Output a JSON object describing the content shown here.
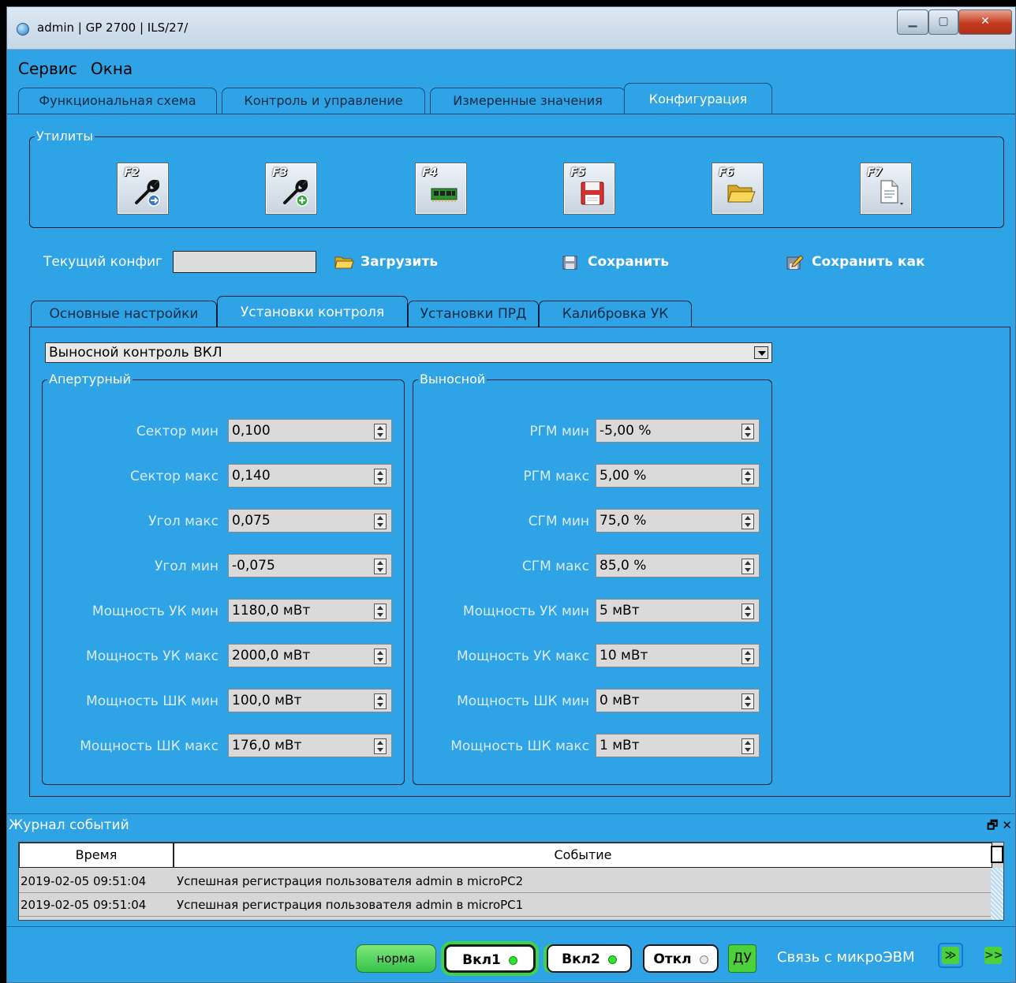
{
  "window": {
    "title": "admin | GP 2700 | ILS/27/"
  },
  "menu": [
    "Сервис",
    "Окна"
  ],
  "tabs": [
    "Функциональная схема",
    "Контроль и управление",
    "Измеренные значения",
    "Конфигурация"
  ],
  "utilities": {
    "label": "Утилиты",
    "buttons": [
      {
        "key": "F2",
        "icon": "wrench-arrow-icon"
      },
      {
        "key": "F3",
        "icon": "wrench-plus-icon"
      },
      {
        "key": "F4",
        "icon": "memory-chip-icon"
      },
      {
        "key": "F5",
        "icon": "floppy-save-icon"
      },
      {
        "key": "F6",
        "icon": "folder-open-icon"
      },
      {
        "key": "F7",
        "icon": "document-icon"
      }
    ]
  },
  "config": {
    "current_label": "Текущий конфиг",
    "current_value": "",
    "load_label": "Загрузить",
    "save_label": "Сохранить",
    "save_as_label": "Сохранить как"
  },
  "subtabs": [
    "Основные настройки",
    "Установки контроля",
    "Установки ПРД",
    "Калибровка УК"
  ],
  "control_mode": "Выносной контроль ВКЛ",
  "aperture": {
    "label": "Апертурный",
    "fields": [
      {
        "label": "Сектор мин",
        "value": "0,100"
      },
      {
        "label": "Сектор макс",
        "value": "0,140"
      },
      {
        "label": "Угол макс",
        "value": "0,075"
      },
      {
        "label": "Угол мин",
        "value": "-0,075"
      },
      {
        "label": "Мощность УК мин",
        "value": "1180,0 мВт"
      },
      {
        "label": "Мощность УК макс",
        "value": "2000,0 мВт"
      },
      {
        "label": "Мощность ШК мин",
        "value": "100,0 мВт"
      },
      {
        "label": "Мощность ШК макс",
        "value": "176,0 мВт"
      }
    ]
  },
  "remote": {
    "label": "Выносной",
    "fields": [
      {
        "label": "РГМ мин",
        "value": "-5,00 %"
      },
      {
        "label": "РГМ макс",
        "value": "5,00 %"
      },
      {
        "label": "СГМ мин",
        "value": "75,0 %"
      },
      {
        "label": "СГМ макс",
        "value": "85,0 %"
      },
      {
        "label": "Мощность УК мин",
        "value": "5 мВт"
      },
      {
        "label": "Мощность УК макс",
        "value": "10 мВт"
      },
      {
        "label": "Мощность ШК мин",
        "value": "0 мВт"
      },
      {
        "label": "Мощность ШК макс",
        "value": "1 мВт"
      }
    ]
  },
  "log": {
    "title": "Журнал событий",
    "controls": "🗗 ✕",
    "columns": [
      "Время",
      "Событие"
    ],
    "rows": [
      {
        "time": "2019-02-05 09:51:04",
        "event": "Успешная регистрация пользователя admin в microPC2"
      },
      {
        "time": "2019-02-05 09:51:04",
        "event": "Успешная регистрация пользователя admin в microPC1"
      }
    ]
  },
  "status": {
    "norma": "норма",
    "on1": "Вкл1",
    "on2": "Вкл2",
    "off": "Откл",
    "du": "ДУ",
    "link_label": "Связь с микроЭВМ",
    "link1": "≫",
    "link2": ">>"
  },
  "colors": {
    "background": "#2ea3e6",
    "accent_green": "#4cd13a",
    "led_green": "#2ee62e"
  }
}
